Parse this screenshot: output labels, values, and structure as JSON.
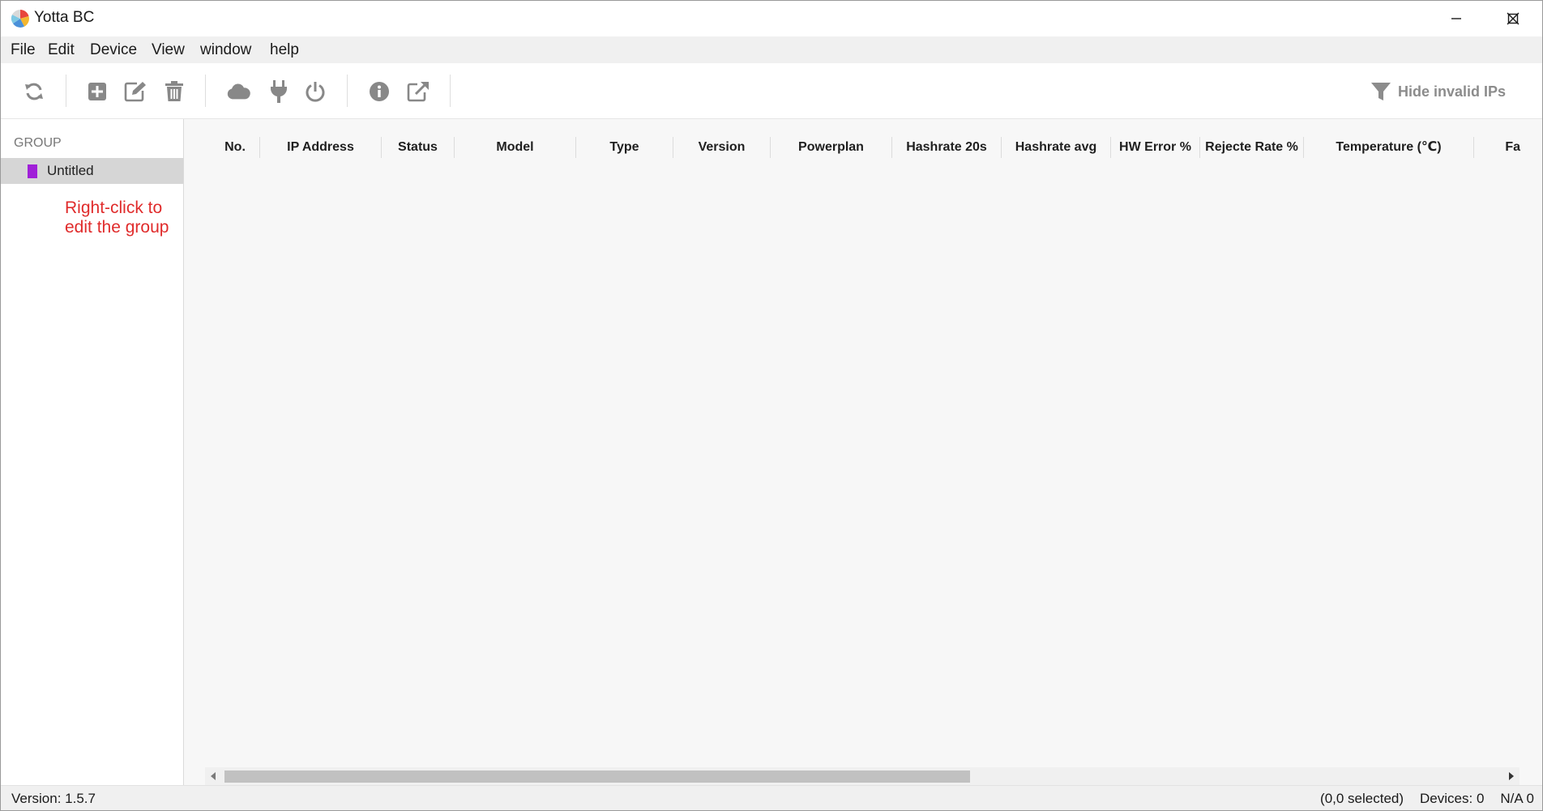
{
  "window": {
    "title": "Yotta BC"
  },
  "menu": {
    "items": [
      "File",
      "Edit",
      "Device",
      "View",
      "window",
      "help"
    ]
  },
  "toolbar": {
    "buttons": [
      "refresh-icon",
      "add-icon",
      "edit-icon",
      "delete-icon",
      "cloud-icon",
      "plug-icon",
      "power-icon",
      "info-icon",
      "external-link-icon"
    ],
    "filter_label": "Hide invalid IPs",
    "icon_color": "#888888"
  },
  "sidebar": {
    "header": "GROUP",
    "groups": [
      {
        "name": "Untitled",
        "color": "#a020d8"
      }
    ],
    "hint": "Right-click to edit the group",
    "hint_color": "#e02b2b"
  },
  "table": {
    "columns": [
      "No.",
      "IP Address",
      "Status",
      "Model",
      "Type",
      "Version",
      "Powerplan",
      "Hashrate 20s",
      "Hashrate avg",
      "HW Error %",
      "Rejecte Rate %",
      "Temperature (℃)",
      "Fa"
    ],
    "rows": []
  },
  "status": {
    "version": "Version: 1.5.7",
    "selected": "(0,0 selected)",
    "devices": "Devices: 0",
    "na": "N/A 0"
  }
}
